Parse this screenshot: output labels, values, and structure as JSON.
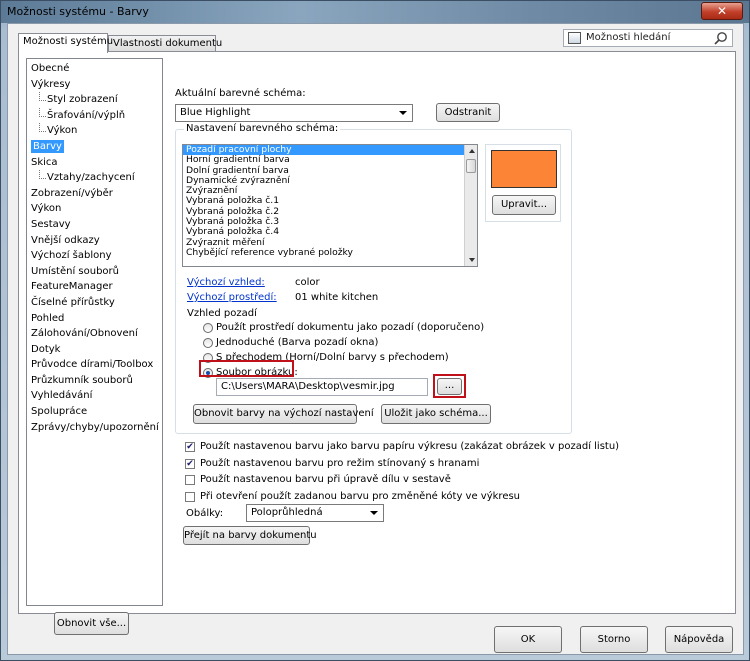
{
  "window": {
    "title": "Možnosti systému - Barvy",
    "close_label": "✕"
  },
  "tabs": [
    "Možnosti systému",
    "Vlastnosti dokumentu"
  ],
  "search": {
    "placeholder": "Možnosti hledání",
    "icon": "search-icon"
  },
  "sidebar": {
    "items": [
      {
        "label": "Obecné",
        "level": 0
      },
      {
        "label": "Výkresy",
        "level": 0
      },
      {
        "label": "Styl zobrazení",
        "level": 1
      },
      {
        "label": "Šrafování/výplň",
        "level": 1
      },
      {
        "label": "Výkon",
        "level": 1
      },
      {
        "label": "Barvy",
        "level": 0,
        "selected": true
      },
      {
        "label": "Skica",
        "level": 0
      },
      {
        "label": "Vztahy/zachycení",
        "level": 1
      },
      {
        "label": "Zobrazení/výběr",
        "level": 0
      },
      {
        "label": "Výkon",
        "level": 0
      },
      {
        "label": "Sestavy",
        "level": 0
      },
      {
        "label": "Vnější odkazy",
        "level": 0
      },
      {
        "label": "Výchozí šablony",
        "level": 0
      },
      {
        "label": "Umístění souborů",
        "level": 0
      },
      {
        "label": "FeatureManager",
        "level": 0
      },
      {
        "label": "Číselné přírůstky",
        "level": 0
      },
      {
        "label": "Pohled",
        "level": 0
      },
      {
        "label": "Zálohování/Obnovení",
        "level": 0
      },
      {
        "label": "Dotyk",
        "level": 0
      },
      {
        "label": "Průvodce dírami/Toolbox",
        "level": 0
      },
      {
        "label": "Průzkumník souborů",
        "level": 0
      },
      {
        "label": "Vyhledávání",
        "level": 0
      },
      {
        "label": "Spolupráce",
        "level": 0
      },
      {
        "label": "Zprávy/chyby/upozornění",
        "level": 0
      }
    ],
    "reset_all": "Obnovit vše..."
  },
  "scheme": {
    "label": "Aktuální barevné schéma:",
    "value": "Blue Highlight",
    "delete": "Odstranit"
  },
  "settings": {
    "group_title": "Nastavení barevného schéma:",
    "items": [
      "Pozadí pracovní plochy",
      "Horní gradientní barva",
      "Dolní gradientní barva",
      "Dynamické zvýraznění",
      "Zvýraznění",
      "Vybraná položka č.1",
      "Vybraná položka č.2",
      "Vybraná položka č.3",
      "Vybraná položka č.4",
      "Zvýraznit měření",
      "Chybějící reference vybrané položky"
    ],
    "selected_index": 0,
    "swatch_color": "#fb8436",
    "edit": "Upravit...",
    "default_view_label": "Výchozí vzhled:",
    "default_view_value": "color",
    "default_env_label": "Výchozí prostředí:",
    "default_env_value": "01 white kitchen",
    "bg_label": "Vzhled pozadí",
    "bg_options": [
      "Použít prostředí dokumentu jako pozadí (doporučeno)",
      "Jednoduché (Barva pozadí okna)",
      "S přechodem (Horní/Dolní barvy s přechodem)",
      "Soubor obrázku:"
    ],
    "bg_selected": 3,
    "file_path": "C:\\Users\\MARA\\Desktop\\vesmir.jpg",
    "browse": "...",
    "reset_colors": "Obnovit barvy na výchozí nastavení",
    "save_scheme": "Uložit jako schéma..."
  },
  "checkboxes": [
    {
      "label": "Použít nastavenou barvu jako barvu papíru výkresu (zakázat obrázek v pozadí listu)",
      "checked": true
    },
    {
      "label": "Použít nastavenou barvu pro režim stínovaný s hranami",
      "checked": true
    },
    {
      "label": "Použít nastavenou barvu při úpravě dílu v sestavě",
      "checked": false
    },
    {
      "label": "Při otevření použít zadanou barvu pro změněné kóty ve výkresu",
      "checked": false
    }
  ],
  "envelopes": {
    "label": "Obálky:",
    "value": "Poloprůhledná"
  },
  "goto_doc_colors": "Přejít na barvy dokumentu",
  "footer": {
    "ok": "OK",
    "cancel": "Storno",
    "help": "Nápověda"
  },
  "colors": {
    "highlight_border": "#c0101a",
    "selection": "#3399ff",
    "link": "#0033cc"
  }
}
